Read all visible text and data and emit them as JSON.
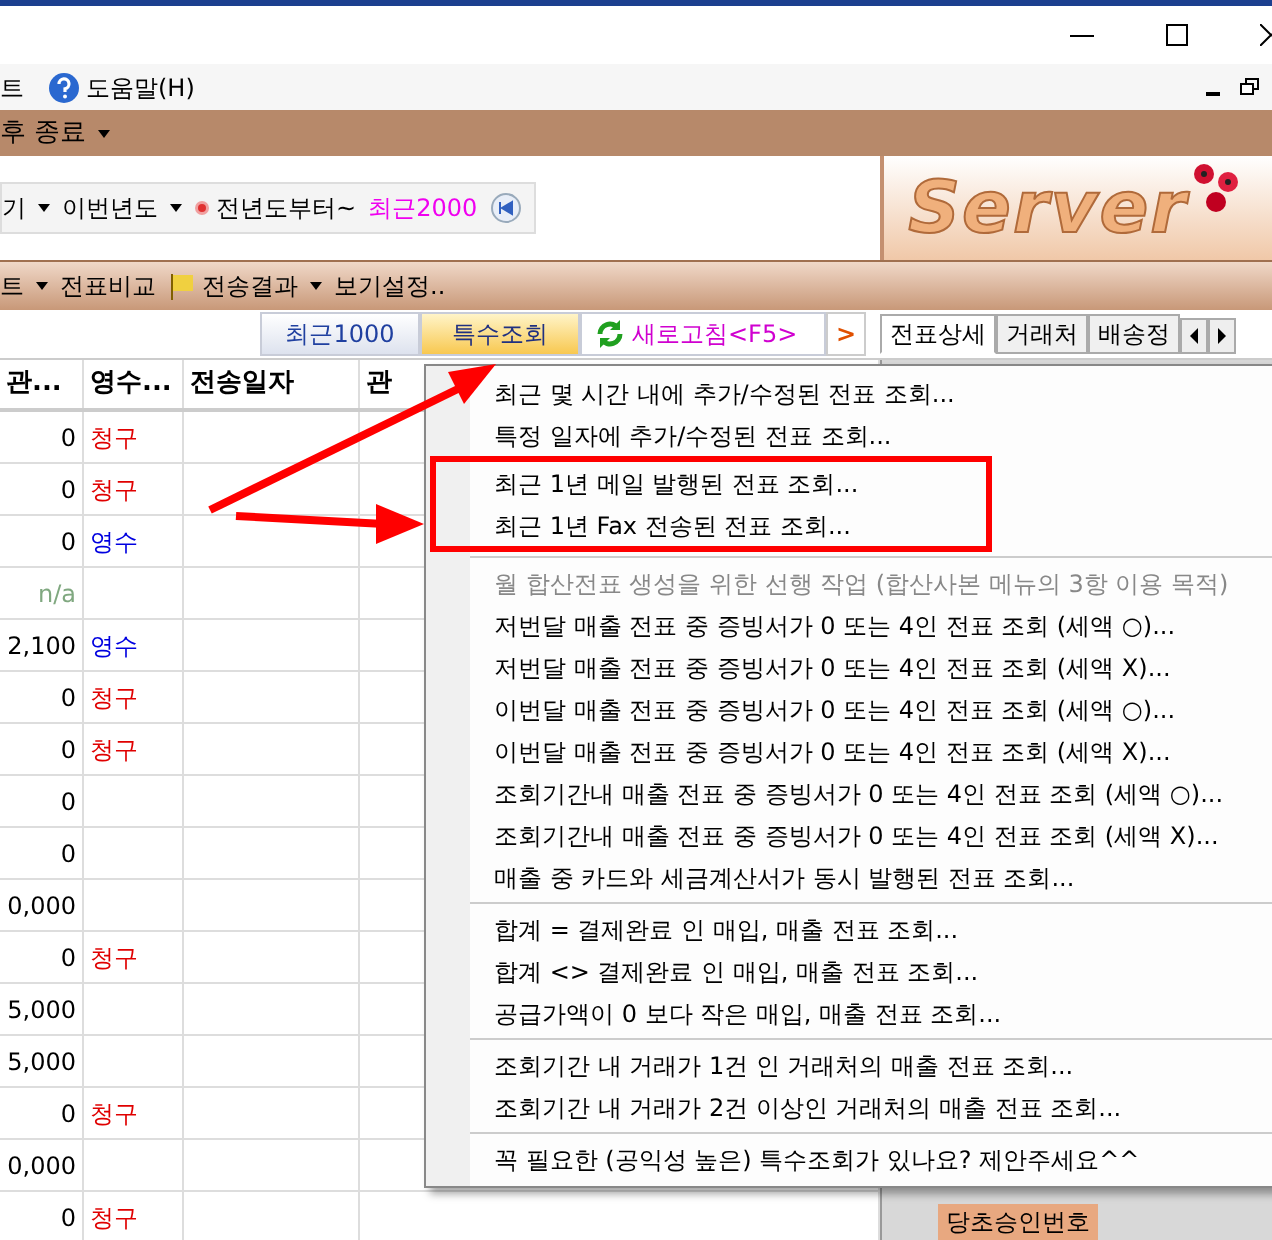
{
  "menu_bar": {
    "items": [
      {
        "label": "트",
        "kind": "plain"
      },
      {
        "label": "도움말(H)",
        "kind": "help"
      }
    ]
  },
  "toolbar_1": {
    "items": [
      {
        "label": "후 종료",
        "kind": "dropdown"
      }
    ]
  },
  "toolbar_2": {
    "items": [
      {
        "label": "기",
        "kind": "dropdown"
      },
      {
        "label": "이번년도",
        "kind": "dropdown"
      },
      {
        "label": "전년도부터~",
        "kind": "bullet"
      },
      {
        "label": "최근2000",
        "kind": "link"
      },
      {
        "kind": "rewind"
      }
    ]
  },
  "logo": {
    "text": "Server"
  },
  "toolbar_3": {
    "items": [
      {
        "label": "트",
        "kind": "dropdown"
      },
      {
        "label": "전표비교",
        "kind": "plain"
      },
      {
        "label": "전송결과",
        "kind": "flag-dropdown"
      },
      {
        "label": "보기설정..",
        "kind": "plain"
      }
    ]
  },
  "query_tabs": [
    {
      "label": "최근1000",
      "selected": false
    },
    {
      "label": "특수조회",
      "selected": true
    }
  ],
  "refresh_button": {
    "label": "새로고침<F5>"
  },
  "next_button": {
    "label": ">"
  },
  "detail_tabs": [
    {
      "label": "전표상세",
      "selected": true
    },
    {
      "label": "거래처",
      "selected": false
    },
    {
      "label": "배송정",
      "selected": false
    }
  ],
  "detail_field": {
    "label": "당초승인번호"
  },
  "grid": {
    "columns": [
      "관...",
      "영수...",
      "전송일자",
      "관"
    ],
    "rows": [
      {
        "cells": [
          {
            "text": "0"
          },
          {
            "text": "청구",
            "color": "#e00000"
          }
        ]
      },
      {
        "cells": [
          {
            "text": "0"
          },
          {
            "text": "청구",
            "color": "#e00000"
          }
        ]
      },
      {
        "cells": [
          {
            "text": "0"
          },
          {
            "text": "영수",
            "color": "#0000e0"
          }
        ]
      },
      {
        "cells": [
          {
            "text": "n/a",
            "color": "#80a880"
          }
        ]
      },
      {
        "cells": [
          {
            "text": "2,100"
          },
          {
            "text": "영수",
            "color": "#0000e0"
          }
        ]
      },
      {
        "cells": [
          {
            "text": "0"
          },
          {
            "text": "청구",
            "color": "#e00000"
          }
        ]
      },
      {
        "cells": [
          {
            "text": "0"
          },
          {
            "text": "청구",
            "color": "#e00000"
          }
        ]
      },
      {
        "cells": [
          {
            "text": "0"
          }
        ]
      },
      {
        "cells": [
          {
            "text": "0"
          }
        ]
      },
      {
        "cells": [
          {
            "text": "0,000"
          }
        ]
      },
      {
        "cells": [
          {
            "text": "0"
          },
          {
            "text": "청구",
            "color": "#e00000"
          }
        ]
      },
      {
        "cells": [
          {
            "text": "5,000"
          }
        ]
      },
      {
        "cells": [
          {
            "text": "5,000"
          }
        ]
      },
      {
        "cells": [
          {
            "text": "0"
          },
          {
            "text": "청구",
            "color": "#e00000"
          }
        ]
      },
      {
        "cells": [
          {
            "text": "0,000"
          }
        ]
      },
      {
        "cells": [
          {
            "text": "0"
          },
          {
            "text": "청구",
            "color": "#e00000"
          }
        ]
      }
    ]
  },
  "context_menu": {
    "items": [
      {
        "kind": "item",
        "label": "최근 몇 시간 내에 추가/수정된 전표 조회...",
        "disabled": false,
        "boxed": false
      },
      {
        "kind": "item",
        "label": "특정 일자에 추가/수정된 전표 조회...",
        "disabled": false,
        "boxed": false
      },
      {
        "kind": "item",
        "label": "최근 1년 메일 발행된 전표 조회...",
        "disabled": false,
        "boxed": true
      },
      {
        "kind": "item",
        "label": "최근 1년 Fax 전송된 전표 조회...",
        "disabled": false,
        "boxed": true
      },
      {
        "kind": "separator"
      },
      {
        "kind": "item",
        "label": "월 합산전표 생성을 위한 선행 작업 (합산사본 메뉴의 3항 이용 목적)",
        "disabled": true,
        "boxed": false
      },
      {
        "kind": "item",
        "label": "저번달 매출 전표 중 증빙서가 0 또는 4인 전표 조회 (세액 ○)...",
        "disabled": false,
        "boxed": false
      },
      {
        "kind": "item",
        "label": "저번달 매출 전표 중 증빙서가 0 또는 4인 전표 조회 (세액 X)...",
        "disabled": false,
        "boxed": false
      },
      {
        "kind": "item",
        "label": "이번달 매출 전표 중 증빙서가 0 또는 4인 전표 조회 (세액 ○)...",
        "disabled": false,
        "boxed": false
      },
      {
        "kind": "item",
        "label": "이번달 매출 전표 중 증빙서가 0 또는 4인 전표 조회 (세액 X)...",
        "disabled": false,
        "boxed": false
      },
      {
        "kind": "item",
        "label": "조회기간내 매출 전표 중 증빙서가 0 또는 4인 전표 조회 (세액 ○)...",
        "disabled": false,
        "boxed": false
      },
      {
        "kind": "item",
        "label": "조회기간내 매출 전표 중 증빙서가 0 또는 4인 전표 조회 (세액 X)...",
        "disabled": false,
        "boxed": false
      },
      {
        "kind": "item",
        "label": "매출 중 카드와 세금계산서가 동시 발행된 전표 조회...",
        "disabled": false,
        "boxed": false
      },
      {
        "kind": "separator"
      },
      {
        "kind": "item",
        "label": "합계 = 결제완료 인 매입, 매출 전표 조회...",
        "disabled": false,
        "boxed": false
      },
      {
        "kind": "item",
        "label": "합계 <> 결제완료 인 매입, 매출 전표 조회...",
        "disabled": false,
        "boxed": false
      },
      {
        "kind": "item",
        "label": "공급가액이 0 보다 작은 매입, 매출 전표 조회...",
        "disabled": false,
        "boxed": false
      },
      {
        "kind": "separator"
      },
      {
        "kind": "item",
        "label": "조회기간 내 거래가 1건 인 거래처의 매출 전표 조회...",
        "disabled": false,
        "boxed": false
      },
      {
        "kind": "item",
        "label": "조회기간 내 거래가 2건 이상인 거래처의 매출 전표 조회...",
        "disabled": false,
        "boxed": false
      },
      {
        "kind": "separator"
      },
      {
        "kind": "item",
        "label": "꼭 필요한 (공익성 높은) 특수조회가 있나요? 제안주세요^^",
        "disabled": false,
        "boxed": false
      }
    ]
  }
}
